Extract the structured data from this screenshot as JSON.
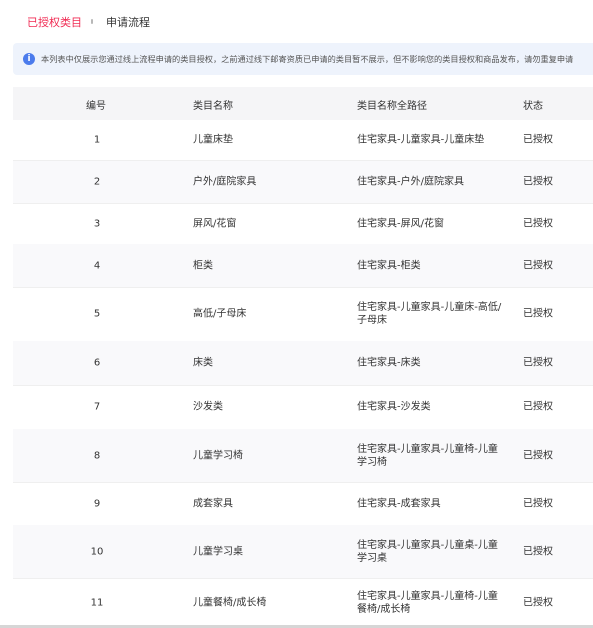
{
  "tabs": {
    "active": "已授权类目",
    "inactive": "申请流程"
  },
  "notice": {
    "icon": "info-icon",
    "text": "本列表中仅展示您通过线上流程申请的类目授权，之前通过线下邮寄资质已申请的类目暂不展示，但不影响您的类目授权和商品发布，请勿重复申请"
  },
  "table": {
    "headers": [
      "编号",
      "类目名称",
      "类目名称全路径",
      "状态"
    ],
    "rows": [
      {
        "num": "1",
        "name": "儿童床垫",
        "path": "住宅家具-儿童家具-儿童床垫",
        "status": "已授权"
      },
      {
        "num": "2",
        "name": "户外/庭院家具",
        "path": "住宅家具-户外/庭院家具",
        "status": "已授权"
      },
      {
        "num": "3",
        "name": "屏风/花窗",
        "path": "住宅家具-屏风/花窗",
        "status": "已授权"
      },
      {
        "num": "4",
        "name": "柜类",
        "path": "住宅家具-柜类",
        "status": "已授权"
      },
      {
        "num": "5",
        "name": "高低/子母床",
        "path": "住宅家具-儿童家具-儿童床-高低/子母床",
        "status": "已授权"
      },
      {
        "num": "6",
        "name": "床类",
        "path": "住宅家具-床类",
        "status": "已授权"
      },
      {
        "num": "7",
        "name": "沙发类",
        "path": "住宅家具-沙发类",
        "status": "已授权"
      },
      {
        "num": "8",
        "name": "儿童学习椅",
        "path": "住宅家具-儿童家具-儿童椅-儿童学习椅",
        "status": "已授权"
      },
      {
        "num": "9",
        "name": "成套家具",
        "path": "住宅家具-成套家具",
        "status": "已授权"
      },
      {
        "num": "10",
        "name": "儿童学习桌",
        "path": "住宅家具-儿童家具-儿童桌-儿童学习桌",
        "status": "已授权"
      },
      {
        "num": "11",
        "name": "儿童餐椅/成长椅",
        "path": "住宅家具-儿童家具-儿童椅-儿童餐椅/成长椅",
        "status": "已授权"
      }
    ]
  }
}
